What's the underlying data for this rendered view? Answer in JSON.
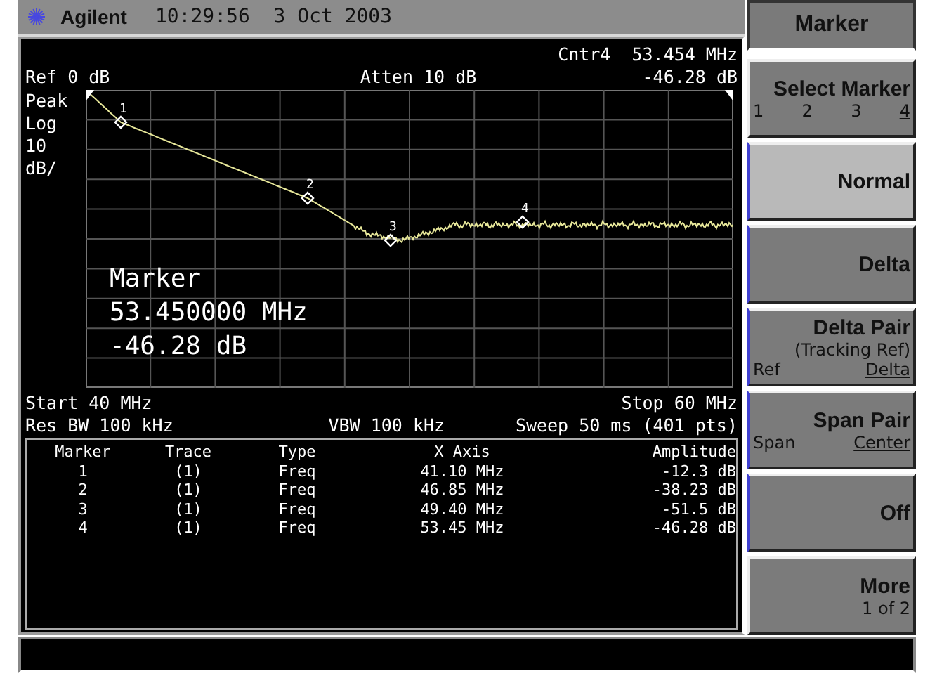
{
  "header": {
    "brand": "Agilent",
    "datetime": "10:29:56  3 Oct 2003"
  },
  "display": {
    "center_readout": "Cntr4  53.454 MHz",
    "ref": "Ref 0 dB",
    "atten": "Atten 10 dB",
    "amplitude_readout": "-46.28 dB",
    "scale_labels": [
      "Peak",
      "Log",
      "10",
      "dB/"
    ],
    "markers": [
      {
        "label": "1"
      },
      {
        "label": "2"
      },
      {
        "label": "3"
      },
      {
        "label": "4"
      }
    ],
    "active_marker": {
      "title": "Marker",
      "frequency": "53.450000 MHz",
      "amplitude": "-46.28 dB"
    },
    "start": "Start 40 MHz",
    "stop": "Stop 60 MHz",
    "res_bw": "Res BW 100 kHz",
    "vbw": "VBW 100 kHz",
    "sweep": "Sweep 50 ms (401 pts)"
  },
  "marker_table": {
    "columns": [
      "Marker",
      "Trace",
      "Type",
      "X Axis",
      "Amplitude"
    ],
    "rows": [
      [
        "1",
        "(1)",
        "Freq",
        "41.10 MHz",
        "-12.3 dB"
      ],
      [
        "2",
        "(1)",
        "Freq",
        "46.85 MHz",
        "-38.23 dB"
      ],
      [
        "3",
        "(1)",
        "Freq",
        "49.40 MHz",
        "-51.5 dB"
      ],
      [
        "4",
        "(1)",
        "Freq",
        "53.45 MHz",
        "-46.28 dB"
      ]
    ]
  },
  "softkeys": {
    "title": "Marker",
    "keys": [
      {
        "kind": "options",
        "label": "Select Marker",
        "selected": false,
        "options": [
          {
            "label": "1",
            "selected": false
          },
          {
            "label": "2",
            "selected": false
          },
          {
            "label": "3",
            "selected": false
          },
          {
            "label": "4",
            "selected": true
          }
        ]
      },
      {
        "kind": "plain",
        "label": "Normal",
        "selected": true
      },
      {
        "kind": "plain",
        "label": "Delta",
        "selected": false
      },
      {
        "kind": "pair",
        "label": "Delta Pair",
        "sublabel": "(Tracking Ref)",
        "selected": false,
        "options": [
          {
            "label": "Ref",
            "selected": false
          },
          {
            "label": "Delta",
            "selected": true
          }
        ]
      },
      {
        "kind": "pair",
        "label": "Span Pair",
        "selected": false,
        "options": [
          {
            "label": "Span",
            "selected": false
          },
          {
            "label": "Center",
            "selected": true
          }
        ]
      },
      {
        "kind": "plain",
        "label": "Off",
        "selected": false
      },
      {
        "kind": "page",
        "label": "More",
        "sublabel": "1 of 2",
        "selected": false
      }
    ]
  }
}
